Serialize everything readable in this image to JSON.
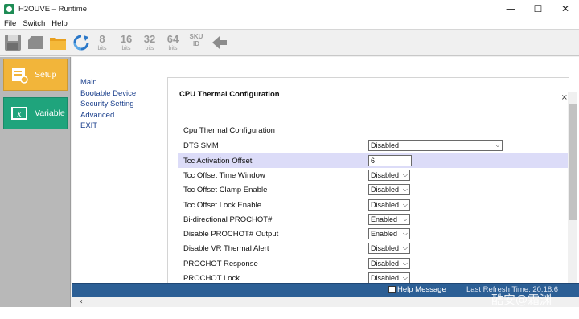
{
  "window": {
    "title": "H2OUVE – Runtime",
    "controls": {
      "minimize": "—",
      "maximize": "☐",
      "close": "✕"
    }
  },
  "menu": {
    "items": [
      "File",
      "Switch",
      "Help"
    ]
  },
  "toolbar": {
    "icons": [
      "save-icon",
      "chip-icon",
      "folder-icon",
      "refresh-icon"
    ],
    "bit_buttons": [
      {
        "value": "8",
        "unit": "bits"
      },
      {
        "value": "16",
        "unit": "bits"
      },
      {
        "value": "32",
        "unit": "bits"
      },
      {
        "value": "64",
        "unit": "bits"
      },
      {
        "value": "SKU",
        "unit": "ID"
      }
    ],
    "back_icon": "back-arrow-icon"
  },
  "sidebar": {
    "buttons": [
      {
        "label": "Setup",
        "icon": "setup-icon",
        "color": "#f2b53a"
      },
      {
        "label": "Variable",
        "icon": "variable-icon",
        "color": "#1fa47c"
      }
    ]
  },
  "nav": {
    "items": [
      "Main",
      "Bootable Device",
      "Security Setting",
      "Advanced",
      "EXIT"
    ]
  },
  "panel": {
    "title": "CPU Thermal Configuration",
    "close_glyph": "×",
    "section_title": "Cpu Thermal Configuration",
    "settings": [
      {
        "label": "DTS SMM",
        "value": "Disabled",
        "type": "select-wide"
      },
      {
        "label": "Tcc Activation Offset",
        "value": "6",
        "type": "input",
        "selected": true
      },
      {
        "label": "Tcc Offset Time Window",
        "value": "Disabled",
        "type": "select"
      },
      {
        "label": "Tcc Offset Clamp Enable",
        "value": "Disabled",
        "type": "select"
      },
      {
        "label": "Tcc Offset Lock Enable",
        "value": "Disabled",
        "type": "select"
      },
      {
        "label": "Bi-directional PROCHOT#",
        "value": "Enabled",
        "type": "select"
      },
      {
        "label": "Disable PROCHOT# Output",
        "value": "Enabled",
        "type": "select"
      },
      {
        "label": "Disable VR Thermal Alert",
        "value": "Disabled",
        "type": "select"
      },
      {
        "label": "PROCHOT Response",
        "value": "Disabled",
        "type": "select"
      },
      {
        "label": "PROCHOT Lock",
        "value": "Disabled",
        "type": "select"
      }
    ]
  },
  "statusbar": {
    "help_label": "Help Message",
    "refresh_text": "Last Refresh Time: 20:18:6",
    "color": "#2c5f95"
  },
  "watermark": "酷安@霜渊"
}
